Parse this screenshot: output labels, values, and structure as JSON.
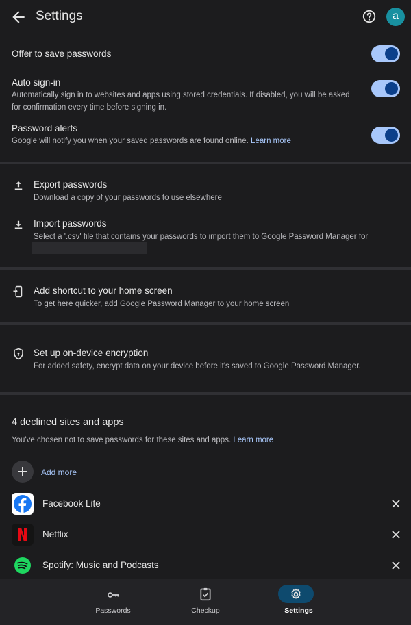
{
  "header": {
    "title": "Settings",
    "avatar_letter": "a"
  },
  "toggles": [
    {
      "title": "Offer to save passwords",
      "on": true
    },
    {
      "title": "Auto sign-in",
      "desc": "Automatically sign in to websites and apps using stored credentials. If disabled, you will be asked for confirmation every time before signing in.",
      "on": true
    },
    {
      "title": "Password alerts",
      "desc": "Google will notify you when your saved passwords are found online.",
      "link": "Learn more",
      "on": true
    }
  ],
  "export": {
    "title": "Export passwords",
    "desc": "Download a copy of your passwords to use elsewhere"
  },
  "import": {
    "title": "Import passwords",
    "desc": "Select a '.csv' file that contains your passwords to import them to Google Password Manager for"
  },
  "shortcut": {
    "title": "Add shortcut to your home screen",
    "desc": "To get here quicker, add Google Password Manager to your home screen"
  },
  "encryption": {
    "title": "Set up on-device encryption",
    "desc": "For added safety, encrypt data on your device before it's saved to Google Password Manager."
  },
  "declined": {
    "heading": "4 declined sites and apps",
    "desc": "You've chosen not to save passwords for these sites and apps.",
    "link": "Learn more",
    "add_more": "Add more",
    "items": [
      {
        "name": "Facebook Lite",
        "icon": "facebook-icon"
      },
      {
        "name": "Netflix",
        "icon": "netflix-icon"
      },
      {
        "name": "Spotify: Music and Podcasts",
        "icon": "spotify-icon"
      }
    ]
  },
  "nav": [
    {
      "label": "Passwords",
      "icon": "key-icon",
      "active": false
    },
    {
      "label": "Checkup",
      "icon": "checkup-icon",
      "active": false
    },
    {
      "label": "Settings",
      "icon": "gear-icon",
      "active": true
    }
  ],
  "colors": {
    "accent": "#a8c7fa",
    "toggle_knob": "#0b3f8a",
    "avatar": "#1890a0",
    "active_pill": "#0e4a6e"
  }
}
